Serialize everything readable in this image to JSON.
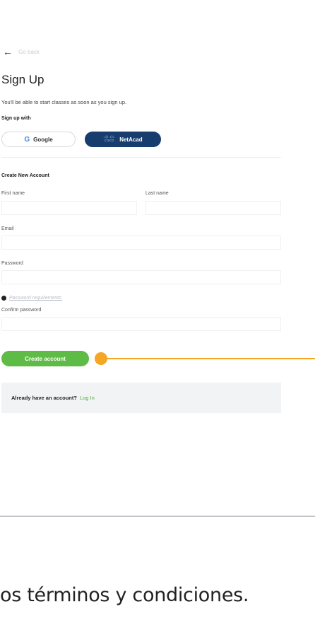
{
  "nav": {
    "back_label": "Go back",
    "back_icon": "arrow-left-icon"
  },
  "header": {
    "title": "Sign Up",
    "subtitle": "You'll be able to start classes as soon as you sign up.",
    "signup_with": "Sign up with"
  },
  "social": {
    "google_label": "Google",
    "google_icon": "G",
    "netacad_label": "NetAcad",
    "cisco_icon": "cisco"
  },
  "form": {
    "section_title": "Create New Account",
    "first_name_label": "First name",
    "last_name_label": "Last name",
    "email_label": "Email",
    "password_label": "Password",
    "password_requirements": "Password requirements:",
    "confirm_password_label": "Confirm password",
    "first_name_value": "",
    "last_name_value": "",
    "email_value": "",
    "password_value": "",
    "confirm_password_value": ""
  },
  "actions": {
    "create_account_label": "Create account"
  },
  "login": {
    "prompt": "Already have an account?",
    "link": "Log In"
  },
  "footer": {
    "text": "os términos y condiciones."
  },
  "colors": {
    "primary_green": "#5dbb46",
    "netacad_blue": "#173c6e",
    "callout_orange": "#f5a623",
    "login_box_bg": "#f2f3f4"
  }
}
